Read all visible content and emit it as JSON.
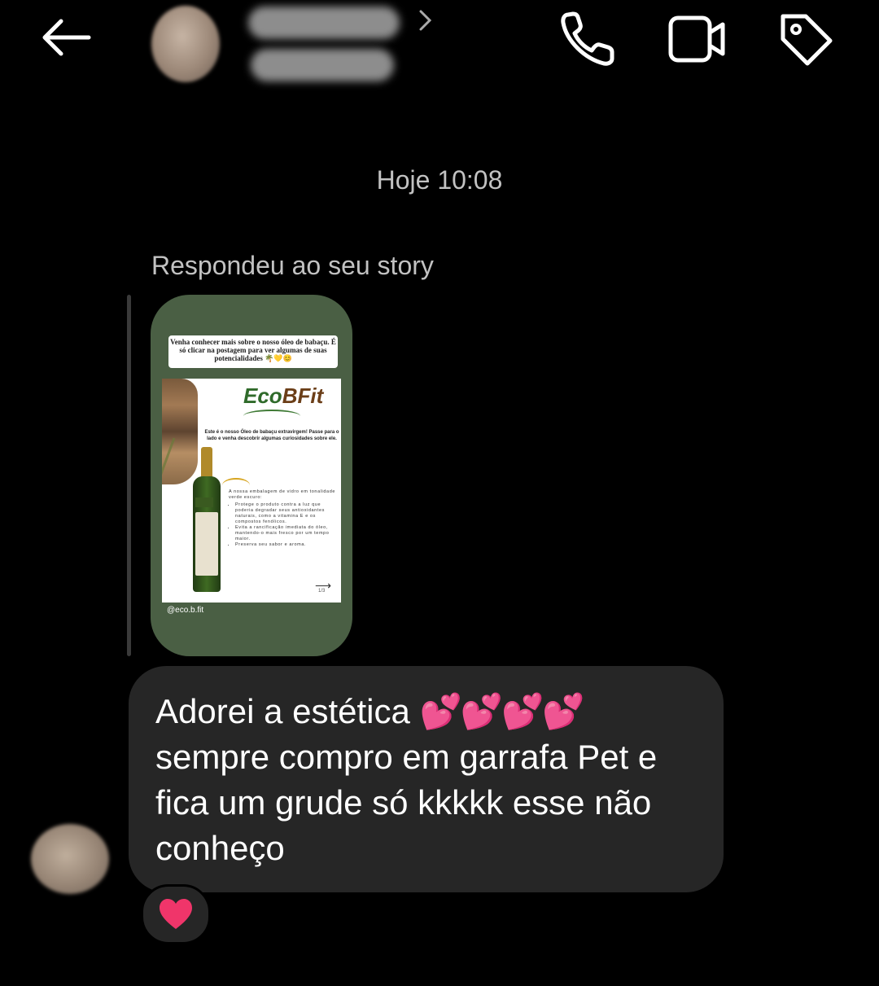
{
  "header": {
    "back_icon": "arrow-left-icon",
    "contact_name": "",
    "contact_subtitle": "",
    "chevron_icon": "chevron-right-icon",
    "actions": [
      {
        "name": "phone-call-button",
        "icon": "phone-icon"
      },
      {
        "name": "video-call-button",
        "icon": "video-camera-icon"
      },
      {
        "name": "tag-button",
        "icon": "tag-icon"
      }
    ]
  },
  "thread": {
    "timestamp": "Hoje 10:08",
    "reply_caption": "Respondeu ao seu story",
    "story": {
      "caption": "Venha conhecer mais sobre o nosso óleo de babaçu. É só clicar na postagem para ver algumas de suas potencialidades 🌴💛😊",
      "brand": "EcoBFit",
      "brand_first": "Eco",
      "brand_second": "BFit",
      "headline": "Este é o nosso Óleo de babaçu extravirgem! Passe para o lado e venha descobrir algumas curiosidades sobre ele.",
      "intro": "A nossa embalagem de vidro em tonalidade verde escuro:",
      "bullets": [
        "Protege o produto contra a luz que poderia degradar seus antioxidantes naturais, como a vitamina E e os compostos fenólicos.",
        "Evita a rancificação imediata do óleo, mantendo-o mais fresco por um tempo maior.",
        "Preserva seu sabor e aroma."
      ],
      "page_indicator": "1/3",
      "handle": "@eco.b.fit"
    },
    "message": {
      "text_line1": "Adorei a estética ",
      "emojis": "💕💕💕💕",
      "text_rest": "\nsempre compro em garrafa Pet e fica um grude só kkkkk esse não conheço"
    },
    "reaction": {
      "emoji": "heart-icon",
      "color": "#f0356a"
    }
  },
  "colors": {
    "background": "#000000",
    "bubble": "#262626",
    "story_bg": "#4a5f44",
    "meta_text": "#c2c2c2"
  }
}
